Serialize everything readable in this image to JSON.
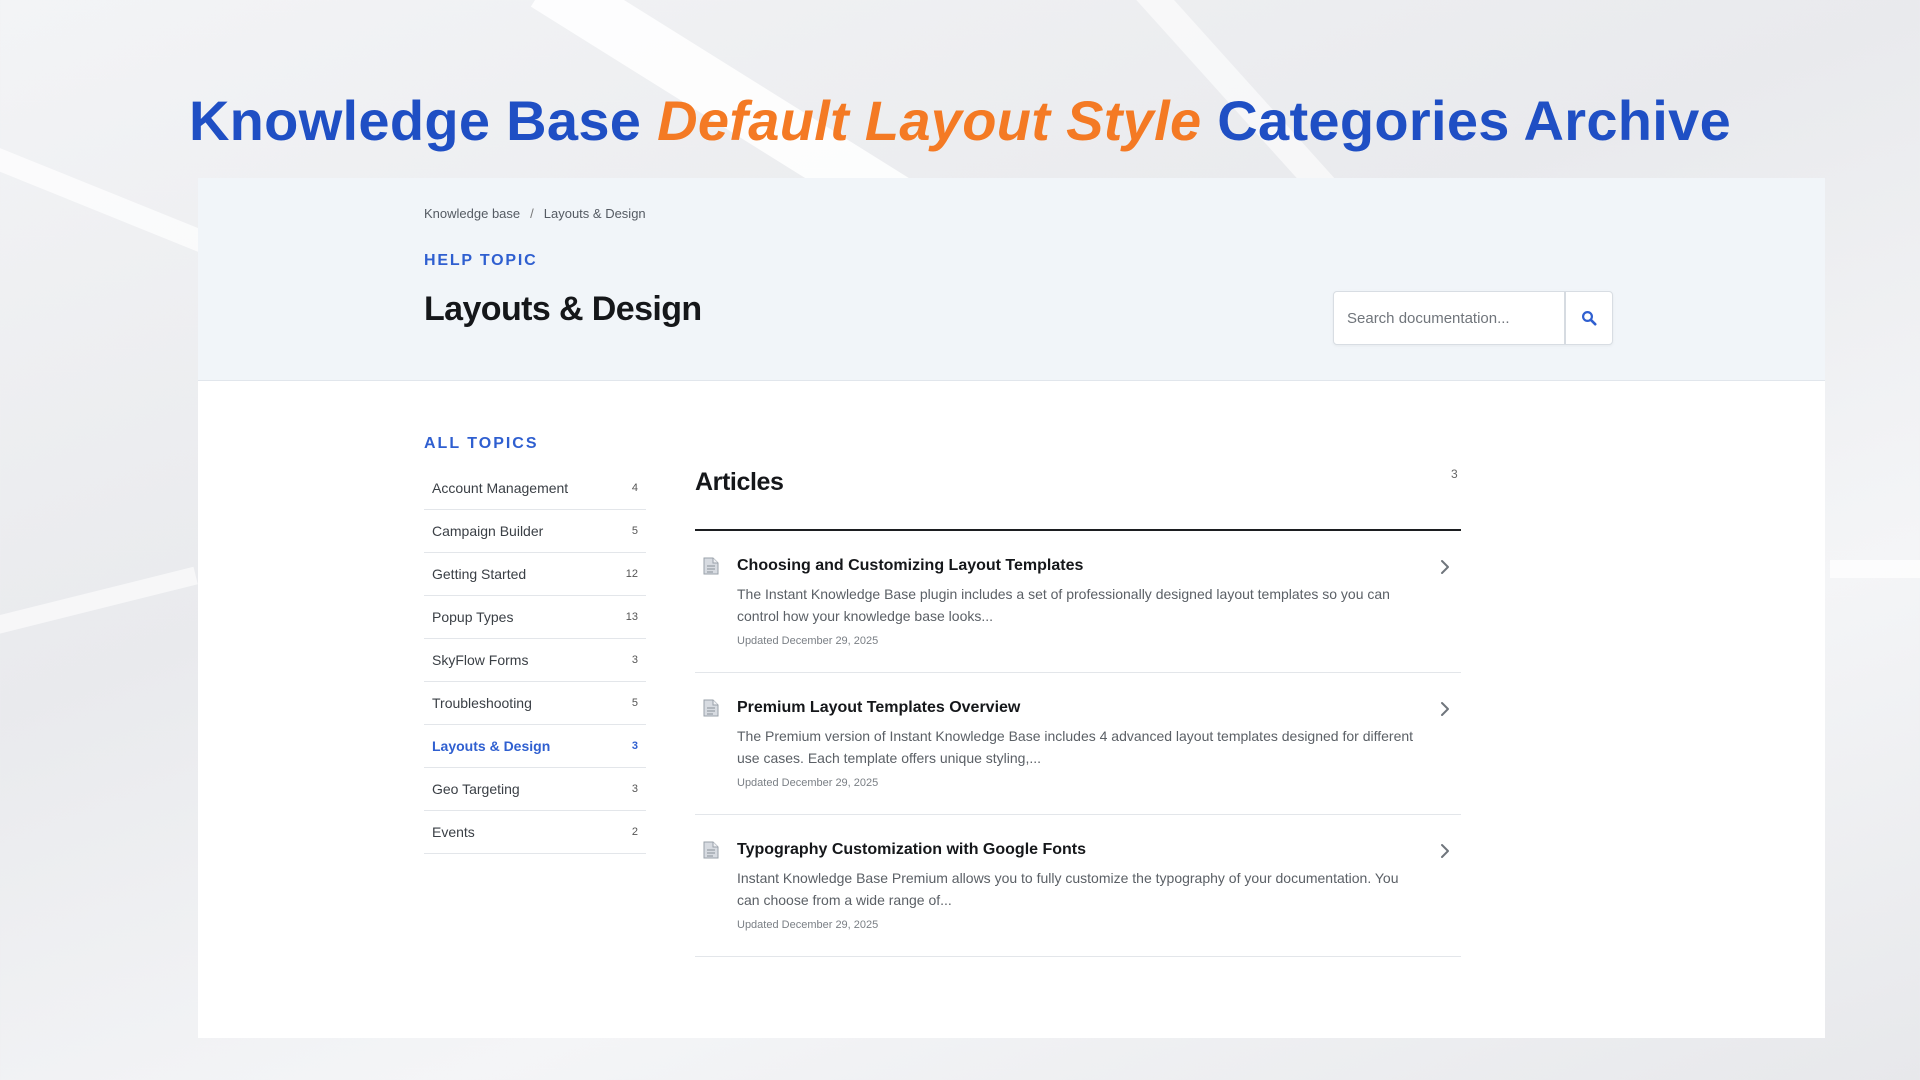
{
  "headline": {
    "part1": "Knowledge Base ",
    "accent": "Default Layout Style",
    "part2": " Categories Archive"
  },
  "breadcrumb": {
    "home": "Knowledge base",
    "separator": "/",
    "current": "Layouts & Design"
  },
  "hero": {
    "eyebrow": "HELP TOPIC",
    "title": "Layouts & Design"
  },
  "search": {
    "placeholder": "Search documentation...",
    "icon": "search-icon"
  },
  "sidebar": {
    "label": "ALL TOPICS",
    "items": [
      {
        "label": "Account Management",
        "count": "4"
      },
      {
        "label": "Campaign Builder",
        "count": "5"
      },
      {
        "label": "Getting Started",
        "count": "12"
      },
      {
        "label": "Popup Types",
        "count": "13"
      },
      {
        "label": "SkyFlow Forms",
        "count": "3"
      },
      {
        "label": "Troubleshooting",
        "count": "5"
      },
      {
        "label": "Layouts & Design",
        "count": "3",
        "active": true
      },
      {
        "label": "Geo Targeting",
        "count": "3"
      },
      {
        "label": "Events",
        "count": "2"
      }
    ]
  },
  "articles": {
    "title": "Articles",
    "count": "3",
    "items": [
      {
        "title": "Choosing and Customizing Layout Templates",
        "excerpt": "The Instant Knowledge Base plugin includes a set of professionally designed layout templates so you can control how your knowledge base looks...",
        "date": "Updated December 29, 2025"
      },
      {
        "title": "Premium Layout Templates Overview",
        "excerpt": "The Premium version of Instant Knowledge Base includes 4 advanced layout templates designed for different use cases. Each template offers unique styling,...",
        "date": "Updated December 29, 2025"
      },
      {
        "title": "Typography Customization with Google Fonts",
        "excerpt": "Instant Knowledge Base Premium allows you to fully customize the typography of your documentation. You can choose from a wide range of...",
        "date": "Updated December 29, 2025"
      }
    ]
  },
  "colors": {
    "brand_blue": "#2f5fd0",
    "headline_blue": "#1f4fc4",
    "accent_orange": "#f47a24"
  }
}
